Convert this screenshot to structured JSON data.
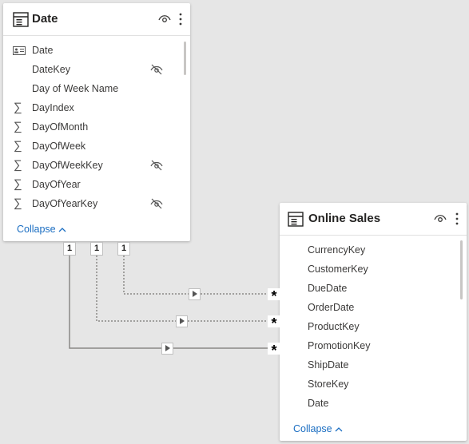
{
  "date_table": {
    "title": "Date",
    "fields": [
      {
        "name": "Date",
        "icon": "card-icon",
        "hidden": false
      },
      {
        "name": "DateKey",
        "icon": "none",
        "hidden": true
      },
      {
        "name": "Day of Week Name",
        "icon": "none",
        "hidden": false
      },
      {
        "name": "DayIndex",
        "icon": "sigma-icon",
        "hidden": false
      },
      {
        "name": "DayOfMonth",
        "icon": "sigma-icon",
        "hidden": false
      },
      {
        "name": "DayOfWeek",
        "icon": "sigma-icon",
        "hidden": false
      },
      {
        "name": "DayOfWeekKey",
        "icon": "sigma-icon",
        "hidden": true
      },
      {
        "name": "DayOfYear",
        "icon": "sigma-icon",
        "hidden": false
      },
      {
        "name": "DayOfYearKey",
        "icon": "sigma-icon",
        "hidden": true
      }
    ],
    "collapse_label": "Collapse"
  },
  "sales_table": {
    "title": "Online Sales",
    "fields": [
      {
        "name": "CurrencyKey"
      },
      {
        "name": "CustomerKey"
      },
      {
        "name": "DueDate"
      },
      {
        "name": "OrderDate"
      },
      {
        "name": "ProductKey"
      },
      {
        "name": "PromotionKey"
      },
      {
        "name": "ShipDate"
      },
      {
        "name": "StoreKey"
      },
      {
        "name": "Date"
      }
    ],
    "collapse_label": "Collapse"
  },
  "relationships": [
    {
      "from_cardinality": "1",
      "to_cardinality": "*",
      "style": "dotted"
    },
    {
      "from_cardinality": "1",
      "to_cardinality": "*",
      "style": "dotted"
    },
    {
      "from_cardinality": "1",
      "to_cardinality": "*",
      "style": "solid"
    }
  ],
  "colors": {
    "canvas": "#e6e6e6",
    "link": "#1b6ec2",
    "line": "#8a8886"
  }
}
